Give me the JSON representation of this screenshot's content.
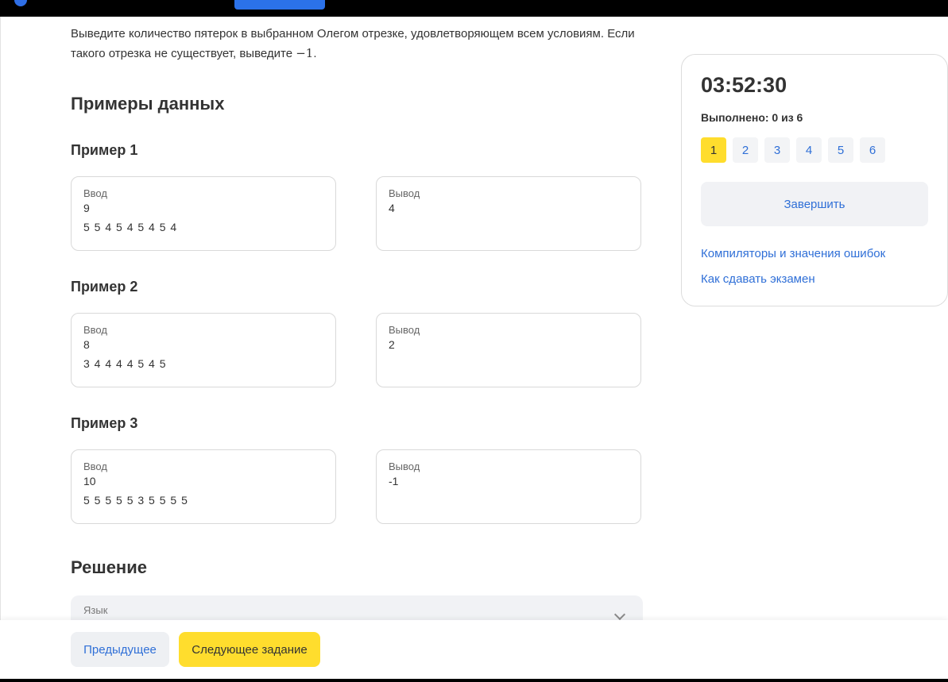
{
  "intro": {
    "text": "Выведите количество пятерок в выбранном Олегом отрезке, удовлетворяющем всем условиям. Если такого отрезка не существует, выведите ",
    "math": "−1",
    "end": "."
  },
  "examples_section": {
    "title": "Примеры данных"
  },
  "examples": [
    {
      "title": "Пример 1",
      "input_label": "Ввод",
      "input_line1": "9",
      "input_line2": "5 5 4 5 4 5 4 5 4",
      "output_label": "Вывод",
      "output_value": "4"
    },
    {
      "title": "Пример 2",
      "input_label": "Ввод",
      "input_line1": "8",
      "input_line2": "3 4 4 4 4 5 4 5",
      "output_label": "Вывод",
      "output_value": "2"
    },
    {
      "title": "Пример 3",
      "input_label": "Ввод",
      "input_line1": "10",
      "input_line2": "5 5 5 5 5 3 5 5 5 5",
      "output_label": "Вывод",
      "output_value": "-1"
    }
  ],
  "solution": {
    "title": "Решение",
    "language_label": "Язык",
    "chevron_icon": "chevron-down-icon"
  },
  "footer": {
    "prev_label": "Предыдущее",
    "next_label": "Следующее задание"
  },
  "sidebar": {
    "timer": "03:52:30",
    "progress": "Выполнено: 0 из 6",
    "tasks": [
      "1",
      "2",
      "3",
      "4",
      "5",
      "6"
    ],
    "active_task": "1",
    "finish_label": "Завершить",
    "link_compilers": "Компиляторы и значения ошибок",
    "link_exam": "Как сдавать экзамен"
  },
  "colors": {
    "accent_yellow": "#ffdd2d",
    "link_blue": "#2f6fd7",
    "top_bar": "#000000"
  }
}
